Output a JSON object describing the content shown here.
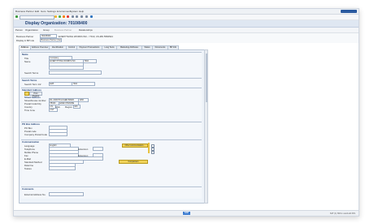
{
  "menu": [
    "Business Partner",
    "Edit",
    "Goto",
    "Settings",
    "Environment",
    "System",
    "Help"
  ],
  "title": "Display Organization: 7010/8400",
  "app_toolbar": [
    "Person",
    "Organization",
    "Group",
    "Business Partner",
    "Relationships"
  ],
  "header": {
    "bp_label": "Business Partner",
    "bp_value": "7010/8400",
    "bp_desc": "EVERYTHING WORKS INC. / 7010, US-MN 5560524",
    "role_label": "Display in BP role",
    "role_value": "Business Partner (Gen.)"
  },
  "tabs": [
    "Address",
    "Address Overview",
    "Identification",
    "Control",
    "Payment Transactions",
    "Long Texts",
    "Marketing Attributes",
    "Status",
    "Documents",
    "BP Info"
  ],
  "name": {
    "section": "Name",
    "title_label": "Title",
    "title_value": "Company",
    "name_label": "Name",
    "name_value": "EVERYTHING WORKS INC",
    "name_extra": "7010",
    "searchterm_label": "Search Terms",
    "searchterm1_label": "Search Term 1/2",
    "searchterm1_value": "EWI",
    "searchterm2_value": "7010"
  },
  "address": {
    "section": "Standard Address",
    "print_preview": "Print Preview",
    "street_section": "Street Address",
    "street_label": "Street/House number",
    "street_value": "RL 2200 PFLUGER BAND",
    "house_value": "1160",
    "postal_label": "Postal Code/City",
    "postal_value": "55344",
    "city_value": "EDEN PRAIRIE",
    "country_label": "Country",
    "country_value": "US",
    "country_desc": "USA",
    "region_label": "Region",
    "region_value": "MN",
    "tz_label": "Time zone",
    "tz_value": "CST"
  },
  "pobox": {
    "section": "PO Box Address",
    "pobox_label": "PO Box",
    "postal_label": "Postal code",
    "company_label": "Company Postal Code"
  },
  "communication": {
    "section": "Communication",
    "language_label": "Language",
    "language_value": "English",
    "telephone_label": "Telephone",
    "mobile_label": "Mobile Phone",
    "fax_label": "Fax",
    "email_label": "E-Mail",
    "standard_method_label": "Standard Method",
    "data_line_label": "Data line",
    "teletex_label": "Teletex",
    "extension_label": "Extension",
    "other_comm_button": "Other communication...",
    "comparison_button": "Comparison"
  },
  "comments": {
    "section": "Comments",
    "ext_label": "External Address No."
  },
  "status": {
    "right": "S4T (1) 500 ▾  usm1s4t  INS"
  }
}
